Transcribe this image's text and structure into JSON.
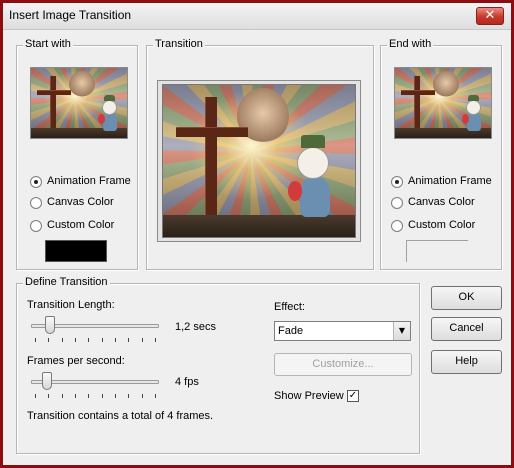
{
  "window": {
    "title": "Insert Image Transition",
    "close_glyph": "✕"
  },
  "start_with": {
    "label": "Start with",
    "options": [
      "Animation Frame",
      "Canvas Color",
      "Custom Color"
    ],
    "selected": "Animation Frame",
    "custom_color": "#000000"
  },
  "transition": {
    "label": "Transition"
  },
  "end_with": {
    "label": "End with",
    "options": [
      "Animation Frame",
      "Canvas Color",
      "Custom Color"
    ],
    "selected": "Animation Frame"
  },
  "define_transition": {
    "label": "Define Transition",
    "length_label": "Transition Length:",
    "length_value": "1,2 secs",
    "length_fraction": 0.12,
    "fps_label": "Frames per second:",
    "fps_value": "4 fps",
    "fps_fraction": 0.09,
    "summary": "Transition contains a total of 4 frames.",
    "effect_label": "Effect:",
    "effect_value": "Fade",
    "customize_label": "Customize...",
    "show_preview_label": "Show Preview",
    "show_preview_checked": true,
    "check_glyph": "✓"
  },
  "buttons": {
    "ok": "OK",
    "cancel": "Cancel",
    "help": "Help"
  },
  "icons": {
    "close": "close-icon",
    "dropdown": "chevron-down-icon",
    "check": "check-icon"
  }
}
